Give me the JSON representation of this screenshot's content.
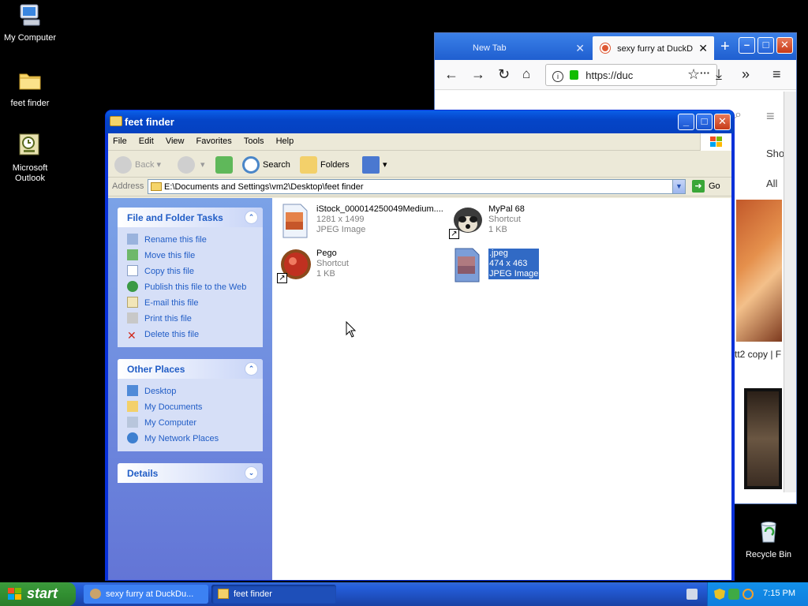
{
  "desktop": {
    "icons": [
      {
        "label": "My Computer"
      },
      {
        "label": "feet finder"
      },
      {
        "label": "Microsoft Outlook"
      },
      {
        "label": "Recycle Bin"
      }
    ]
  },
  "browser": {
    "tabs": [
      {
        "label": "New Tab",
        "active": false
      },
      {
        "label": "sexy furry at DuckD",
        "active": true
      }
    ],
    "url": "https://duc",
    "page_fragments": {
      "shop": "Sho",
      "all": "All",
      "caption": "tt2 copy | F"
    }
  },
  "explorer": {
    "title": "feet finder",
    "menu": [
      "File",
      "Edit",
      "View",
      "Favorites",
      "Tools",
      "Help"
    ],
    "toolbar": {
      "back": "Back",
      "search": "Search",
      "folders": "Folders"
    },
    "address": {
      "label": "Address",
      "path": "E:\\Documents and Settings\\vm2\\Desktop\\feet finder",
      "go": "Go"
    },
    "tasks_panel": {
      "title": "File and Folder Tasks",
      "items": [
        "Rename this file",
        "Move this file",
        "Copy this file",
        "Publish this file to the Web",
        "E-mail this file",
        "Print this file",
        "Delete this file"
      ]
    },
    "places_panel": {
      "title": "Other Places",
      "items": [
        "Desktop",
        "My Documents",
        "My Computer",
        "My Network Places"
      ]
    },
    "details_panel": {
      "title": "Details"
    },
    "files": [
      {
        "name": "iStock_000014250049Medium....",
        "line2": "1281 x 1499",
        "line3": "JPEG Image",
        "selected": false
      },
      {
        "name": "MyPal 68",
        "line2": "Shortcut",
        "line3": "1 KB",
        "selected": false
      },
      {
        "name": "Pego",
        "line2": "Shortcut",
        "line3": "1 KB",
        "selected": false
      },
      {
        "name": ".jpeg",
        "line2": "474 x 463",
        "line3": "JPEG Image",
        "selected": true
      }
    ]
  },
  "taskbar": {
    "start": "start",
    "tasks": [
      {
        "label": "sexy furry at DuckDu..."
      },
      {
        "label": "feet finder"
      }
    ],
    "clock": "7:15 PM"
  }
}
